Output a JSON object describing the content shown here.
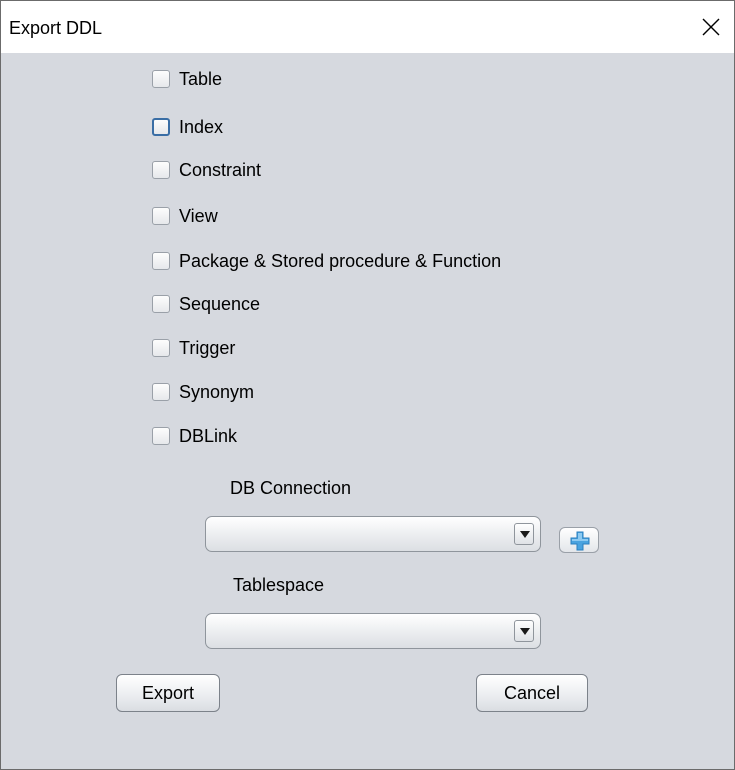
{
  "window": {
    "title": "Export DDL"
  },
  "options": [
    {
      "label": "Table",
      "checked": false
    },
    {
      "label": "Index",
      "checked": false,
      "focused": true
    },
    {
      "label": "Constraint",
      "checked": false
    },
    {
      "label": "View",
      "checked": false
    },
    {
      "label": "Package & Stored procedure & Function",
      "checked": false
    },
    {
      "label": "Sequence",
      "checked": false
    },
    {
      "label": "Trigger",
      "checked": false
    },
    {
      "label": "Synonym",
      "checked": false
    },
    {
      "label": "DBLink",
      "checked": false
    }
  ],
  "db_connection": {
    "label": "DB Connection",
    "selected": ""
  },
  "tablespace": {
    "label": "Tablespace",
    "selected": ""
  },
  "buttons": {
    "export": "Export",
    "cancel": "Cancel"
  },
  "icons": {
    "close": "close-icon",
    "dropdown": "chevron-down-icon",
    "add": "plus-icon"
  },
  "colors": {
    "dialog_background": "#d6d9df",
    "titlebar_background": "#ffffff",
    "focus_border": "#3a6ea5",
    "add_icon": "#4aa3df"
  }
}
